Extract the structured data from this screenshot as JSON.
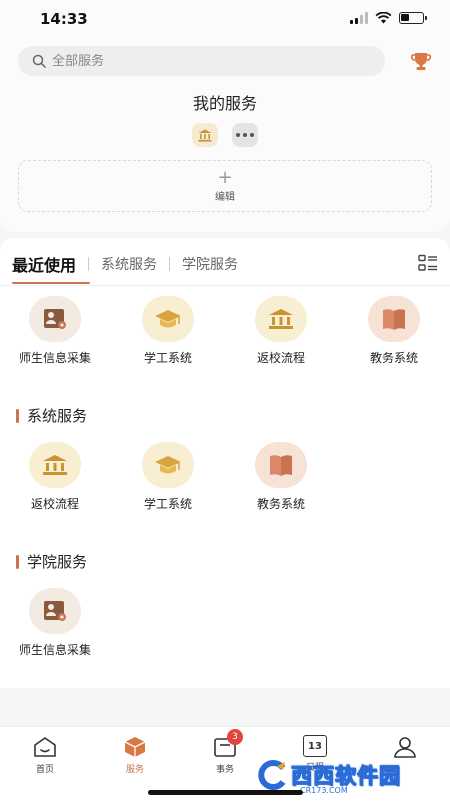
{
  "status_bar": {
    "time": "14:33"
  },
  "search": {
    "placeholder": "全部服务"
  },
  "my_services": {
    "title": "我的服务",
    "edit_label": "编辑",
    "edit_plus": "+"
  },
  "tabs": {
    "active": "最近使用",
    "items": [
      "系统服务",
      "学院服务"
    ]
  },
  "recent": [
    {
      "label": "师生信息采集",
      "icon": "id-card-icon"
    },
    {
      "label": "学工系统",
      "icon": "graduation-cap-icon"
    },
    {
      "label": "返校流程",
      "icon": "bank-icon"
    },
    {
      "label": "教务系统",
      "icon": "book-icon"
    }
  ],
  "sections": {
    "system": {
      "title": "系统服务",
      "items": [
        {
          "label": "返校流程",
          "icon": "bank-icon"
        },
        {
          "label": "学工系统",
          "icon": "graduation-cap-icon"
        },
        {
          "label": "教务系统",
          "icon": "book-icon"
        }
      ]
    },
    "college": {
      "title": "学院服务",
      "items": [
        {
          "label": "师生信息采集",
          "icon": "id-card-icon"
        }
      ]
    }
  },
  "bottom_nav": [
    {
      "label": "首页",
      "icon": "home-icon"
    },
    {
      "label": "服务",
      "icon": "service-cube-icon",
      "active": true
    },
    {
      "label": "事务",
      "icon": "tasks-icon",
      "badge": "3"
    },
    {
      "label": "日程",
      "icon": "calendar-icon",
      "date": "13"
    },
    {
      "label": "",
      "icon": "profile-icon"
    }
  ],
  "watermark": {
    "text": "西西软件园",
    "sub": "CR173.COM"
  },
  "colors": {
    "accent": "#c9744f",
    "badge": "#e2453c",
    "gold": "#d9a540"
  }
}
